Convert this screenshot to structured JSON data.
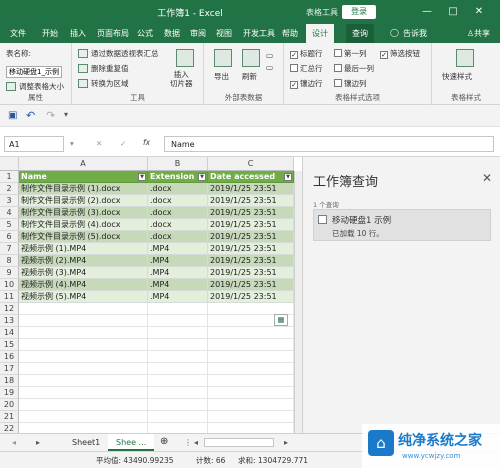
{
  "window": {
    "title": "工作簿1 - Excel",
    "tool_label": "表格工具",
    "login_label": "登录",
    "min": "—",
    "max": "□",
    "close": "✕"
  },
  "tabs": [
    "文件",
    "开始",
    "插入",
    "页面布局",
    "公式",
    "数据",
    "审阅",
    "视图",
    "开发工具",
    "帮助",
    "设计",
    "查询"
  ],
  "tell_me": "告诉我",
  "share": "共享",
  "ribbon": {
    "props": {
      "table_name_label": "表名称:",
      "table_name_value": "移动硬盘1_示例",
      "resize": "调整表格大小",
      "group": "属性"
    },
    "tools": {
      "pivot": "通过数据透视表汇总",
      "dedupe": "删除重复值",
      "convert": "转换为区域",
      "slicer": "插入\n切片器",
      "group": "工具"
    },
    "external": {
      "export": "导出",
      "refresh": "刷新",
      "group": "外部表数据"
    },
    "style_options": {
      "header_row": "标题行",
      "total_row": "汇总行",
      "banded_rows": "镶边行",
      "first_col": "第一列",
      "last_col": "最后一列",
      "banded_cols": "镶边列",
      "filter_btn": "筛选按钮",
      "group": "表格样式选项"
    },
    "styles": {
      "quick": "快速样式",
      "group": "表格样式"
    }
  },
  "formula_bar": {
    "name_box": "A1",
    "fx": "fx",
    "value": "Name",
    "cancel": "✕",
    "enter": "✓"
  },
  "columns": [
    "A",
    "B",
    "C"
  ],
  "table": {
    "headers": [
      "Name",
      "Extension",
      "Date accessed"
    ],
    "rows": [
      [
        "制作文件目录示例 (1).docx",
        ".docx",
        "2019/1/25 23:51"
      ],
      [
        "制作文件目录示例 (2).docx",
        ".docx",
        "2019/1/25 23:51"
      ],
      [
        "制作文件目录示例 (3).docx",
        ".docx",
        "2019/1/25 23:51"
      ],
      [
        "制作文件目录示例 (4).docx",
        ".docx",
        "2019/1/25 23:51"
      ],
      [
        "制作文件目录示例 (5).docx",
        ".docx",
        "2019/1/25 23:51"
      ],
      [
        "视频示例 (1).MP4",
        ".MP4",
        "2019/1/25 23:51"
      ],
      [
        "视频示例 (2).MP4",
        ".MP4",
        "2019/1/25 23:51"
      ],
      [
        "视频示例 (3).MP4",
        ".MP4",
        "2019/1/25 23:51"
      ],
      [
        "视频示例 (4).MP4",
        ".MP4",
        "2019/1/25 23:51"
      ],
      [
        "视频示例 (5).MP4",
        ".MP4",
        "2019/1/25 23:51"
      ]
    ]
  },
  "row_numbers": [
    "1",
    "2",
    "3",
    "4",
    "5",
    "6",
    "7",
    "8",
    "9",
    "10",
    "11",
    "12",
    "13",
    "14",
    "15",
    "16",
    "17",
    "18",
    "19",
    "20",
    "21",
    "22"
  ],
  "query_pane": {
    "title": "工作簿查询",
    "close": "✕",
    "count": "1 个查询",
    "item_name": "移动硬盘1 示例",
    "item_status": "已加载 10 行。"
  },
  "sheet_tabs": [
    "Sheet1",
    "Shee ..."
  ],
  "status": {
    "average": "平均值: 43490.99235",
    "count": "计数: 66",
    "sum": "求和: 1304729.771"
  },
  "watermark": {
    "text": "纯净系统之家",
    "url": "www.ycwjzy.com"
  },
  "colors": {
    "accent": "#217346",
    "table_header": "#70ad47",
    "band_dark": "#c6d9b8",
    "band_light": "#e2efda"
  }
}
